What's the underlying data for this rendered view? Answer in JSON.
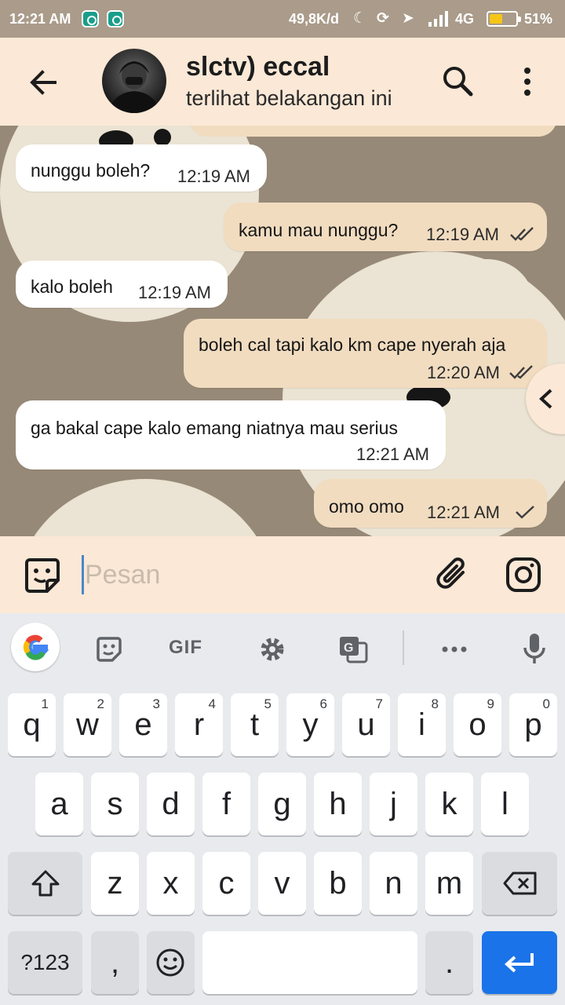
{
  "status_bar": {
    "time": "12:21 AM",
    "speed": "49,8K/d",
    "network": "4G",
    "battery": "51%",
    "battery_level": 0.51
  },
  "header": {
    "contact_name": "slctv) eccal",
    "contact_status": "terlihat belakangan ini"
  },
  "messages": [
    {
      "direction": "in",
      "text": "nunggu boleh?",
      "time": "12:19 AM"
    },
    {
      "direction": "out",
      "text": "kamu mau nunggu?",
      "time": "12:19 AM",
      "status": "read"
    },
    {
      "direction": "in",
      "text": "kalo boleh",
      "time": "12:19 AM"
    },
    {
      "direction": "out",
      "text": "boleh cal tapi kalo km cape nyerah aja",
      "time": "12:20 AM",
      "status": "read"
    },
    {
      "direction": "in",
      "text": "ga bakal cape kalo emang niatnya mau serius",
      "time": "12:21 AM"
    },
    {
      "direction": "out",
      "text": "omo omo",
      "time": "12:21 AM",
      "status": "sent"
    }
  ],
  "input": {
    "placeholder": "Pesan"
  },
  "keyboard": {
    "gif_label": "GIF",
    "row1": [
      "q",
      "w",
      "e",
      "r",
      "t",
      "y",
      "u",
      "i",
      "o",
      "p"
    ],
    "row1_digits": [
      "1",
      "2",
      "3",
      "4",
      "5",
      "6",
      "7",
      "8",
      "9",
      "0"
    ],
    "row2": [
      "a",
      "s",
      "d",
      "f",
      "g",
      "h",
      "j",
      "k",
      "l"
    ],
    "row3": [
      "z",
      "x",
      "c",
      "v",
      "b",
      "n",
      "m"
    ],
    "symbols_label": "?123",
    "comma_label": ",",
    "period_label": "."
  },
  "colors": {
    "header_bg": "#fbe8d6",
    "chat_bg": "#978977",
    "incoming_bubble": "#ffffff",
    "outgoing_bubble": "#f1dcc0",
    "enter_key": "#1a73e8"
  }
}
